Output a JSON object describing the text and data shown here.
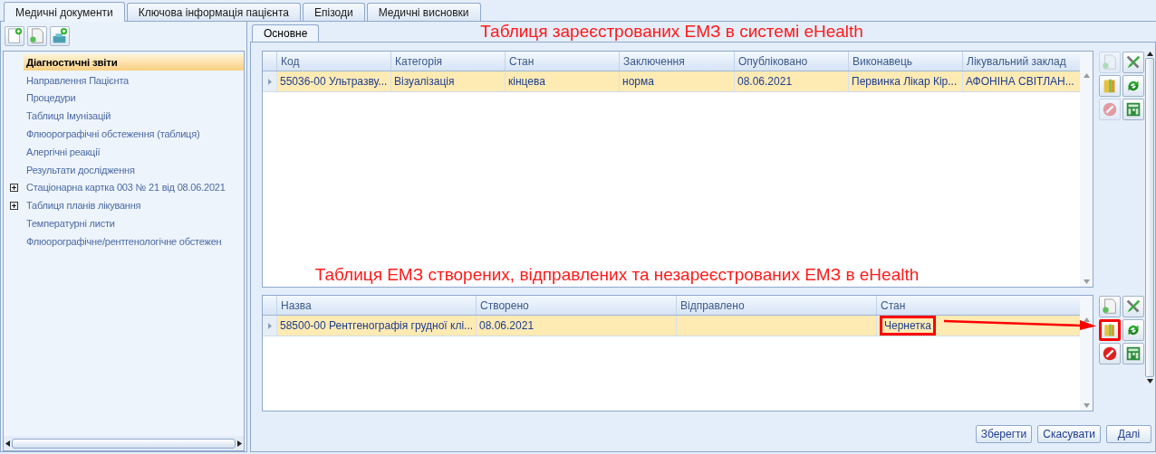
{
  "tabs": [
    {
      "label": "Медичні документи",
      "selected": true
    },
    {
      "label": "Ключова інформація пацієнта",
      "selected": false
    },
    {
      "label": "Епізоди",
      "selected": false
    },
    {
      "label": "Медичні висновки",
      "selected": false
    }
  ],
  "left_toolbar": [
    {
      "kind": "add-page"
    },
    {
      "kind": "attach-page"
    },
    {
      "kind": "add-folder"
    }
  ],
  "tree": [
    {
      "label": "Діагностичні звіти",
      "selected": true,
      "kind": "item"
    },
    {
      "label": "Направлення Пацієнта",
      "selected": false,
      "kind": "item"
    },
    {
      "label": "Процедури",
      "selected": false,
      "kind": "item"
    },
    {
      "label": "Таблиця Імунізацій",
      "selected": false,
      "kind": "item"
    },
    {
      "label": "Флюорографічні обстеження (таблиця)",
      "selected": false,
      "kind": "item"
    },
    {
      "label": "Алергічні реакції",
      "selected": false,
      "kind": "item"
    },
    {
      "label": "Результати дослідження",
      "selected": false,
      "kind": "item"
    },
    {
      "label": "Стаціонарна картка 003 № 21 від 08.06.2021",
      "selected": false,
      "kind": "group",
      "expanded": false
    },
    {
      "label": "Таблиця планів лікування",
      "selected": false,
      "kind": "group",
      "expanded": false
    },
    {
      "label": "Температурні листи",
      "selected": false,
      "kind": "item"
    },
    {
      "label": "Флюорографічне/рентгенологічне обстежен",
      "selected": false,
      "kind": "item"
    }
  ],
  "subtabs": [
    {
      "label": "Основне",
      "selected": true
    }
  ],
  "top_title": "Таблиця зареєстрованих ЕМЗ в системі eHealth",
  "top_grid": {
    "columns": [
      "Код",
      "Категорія",
      "Стан",
      "Заключення",
      "Опубліковано",
      "Виконавець",
      "Лікувальний заклад"
    ],
    "rows": [
      {
        "selected": true,
        "cells": [
          "55036-00 Ультразву...",
          "Візуалізація",
          "кінцева",
          "норма",
          "08.06.2021",
          "Первинка Лікар Кір...",
          "АФОНІНА СВІТЛАН..."
        ]
      }
    ],
    "toolbar": [
      {
        "kind": "add",
        "disabled": true,
        "highlighted": false
      },
      {
        "kind": "tools",
        "disabled": false,
        "highlighted": false
      },
      {
        "kind": "book",
        "disabled": false,
        "highlighted": false
      },
      {
        "kind": "refresh",
        "disabled": false,
        "highlighted": false
      },
      {
        "kind": "delete",
        "disabled": true,
        "highlighted": false
      },
      {
        "kind": "table",
        "disabled": false,
        "highlighted": false
      }
    ]
  },
  "bottom_title": "Таблиця ЕМЗ створених, відправлених та незареєстрованих ЕМЗ в  eHealth",
  "bottom_grid": {
    "columns": [
      "Назва",
      "Створено",
      "Відправлено",
      "Стан"
    ],
    "rows": [
      {
        "selected": true,
        "cells": [
          "58500-00 Рентгенографія грудної клі...",
          "08.06.2021",
          null,
          {
            "text": "Чернетка",
            "highlighted": true
          }
        ]
      }
    ],
    "toolbar": [
      {
        "kind": "add",
        "disabled": false,
        "highlighted": false
      },
      {
        "kind": "tools",
        "disabled": false,
        "highlighted": false
      },
      {
        "kind": "book",
        "disabled": false,
        "highlighted": true
      },
      {
        "kind": "refresh",
        "disabled": false,
        "highlighted": false
      },
      {
        "kind": "delete",
        "disabled": false,
        "highlighted": false
      },
      {
        "kind": "table",
        "disabled": false,
        "highlighted": false
      }
    ]
  },
  "buttons": [
    "Зберегти",
    "Скасувати",
    "Далі"
  ]
}
